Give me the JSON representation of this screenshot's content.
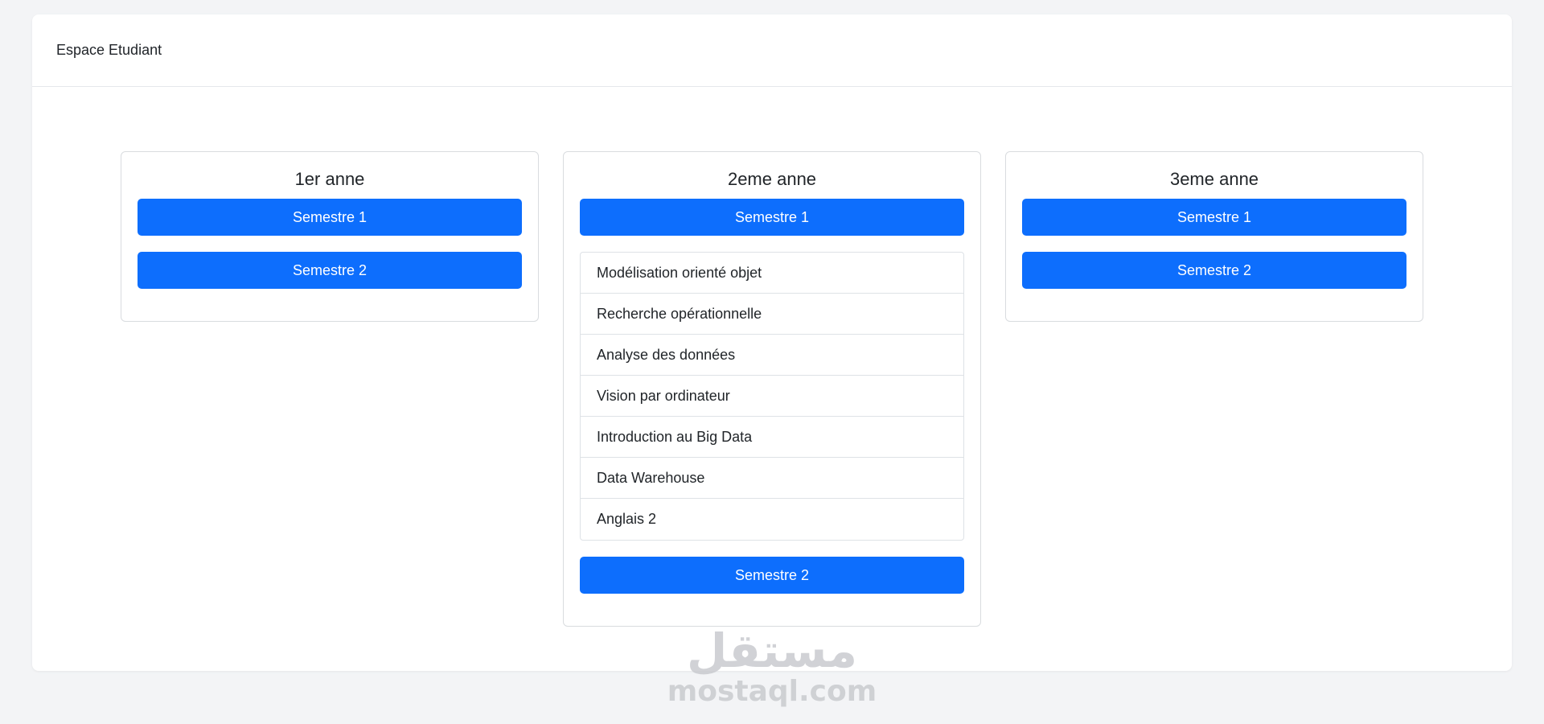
{
  "app": {
    "title": "Espace Etudiant"
  },
  "years": [
    {
      "title": "1er anne",
      "semester1_label": "Semestre 1",
      "semester2_label": "Semestre 2"
    },
    {
      "title": "2eme anne",
      "semester1_label": "Semestre 1",
      "semester1_courses": [
        "Modélisation orienté objet",
        "Recherche opérationnelle",
        "Analyse des données",
        "Vision par ordinateur",
        "Introduction au Big Data",
        "Data Warehouse",
        "Anglais 2"
      ],
      "semester2_label": "Semestre 2"
    },
    {
      "title": "3eme anne",
      "semester1_label": "Semestre 1",
      "semester2_label": "Semestre 2"
    }
  ],
  "watermark": {
    "arabic": "مستقل",
    "latin": "mostaql.com"
  },
  "colors": {
    "primary": "#0d6efd",
    "background": "#f3f4f6",
    "card": "#ffffff"
  }
}
